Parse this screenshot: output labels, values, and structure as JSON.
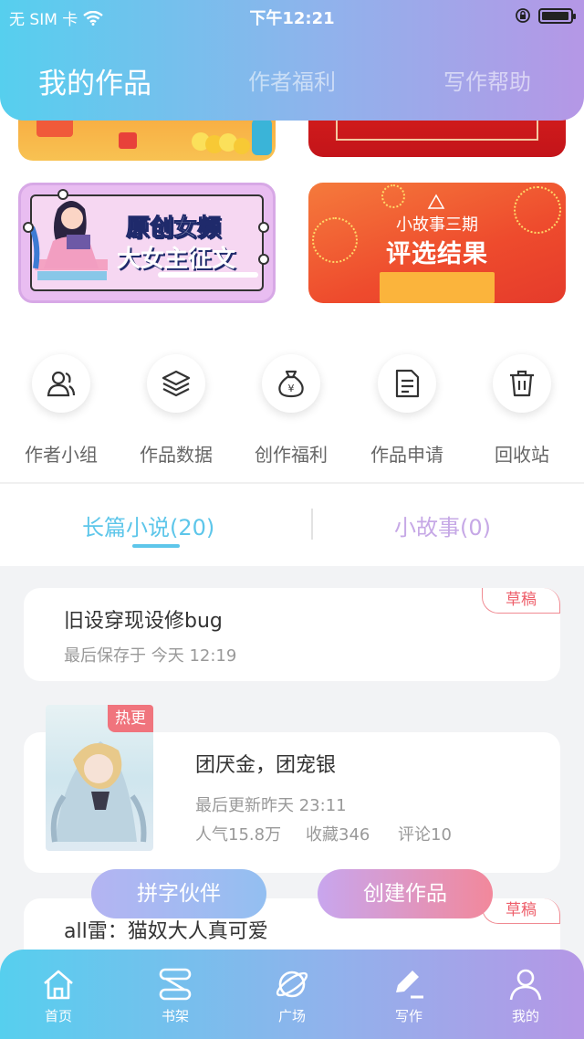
{
  "status_bar": {
    "carrier": "无 SIM 卡",
    "time": "下午12:21",
    "battery_level": 0.95
  },
  "header": {
    "tabs": [
      {
        "label": "我的作品",
        "active": true
      },
      {
        "label": "作者福利",
        "active": false
      },
      {
        "label": "写作帮助",
        "active": false
      }
    ]
  },
  "banners": [
    {
      "title": "原创女频",
      "subtitle": "大女主征文"
    },
    {
      "title": "小故事三期",
      "subtitle": "评选结果"
    }
  ],
  "shortcuts": [
    {
      "label": "作者小组",
      "icon": "group-icon"
    },
    {
      "label": "作品数据",
      "icon": "layers-icon"
    },
    {
      "label": "创作福利",
      "icon": "money-bag-icon"
    },
    {
      "label": "作品申请",
      "icon": "document-icon"
    },
    {
      "label": "回收站",
      "icon": "trash-icon"
    }
  ],
  "list_tabs": [
    {
      "label": "长篇小说(20)",
      "active": true
    },
    {
      "label": "小故事(0)",
      "active": false
    }
  ],
  "works": [
    {
      "title": "旧设穿现设修bug",
      "meta": "最后保存于 今天 12:19",
      "badge": "草稿"
    },
    {
      "title": "团厌金，团宠银",
      "meta": "最后更新昨天 23:11",
      "badge": "热更",
      "popularity": "人气15.8万",
      "favorites": "收藏346",
      "comments": "评论10"
    },
    {
      "title": "all雷：猫奴大人真可爱",
      "badge": "草稿"
    }
  ],
  "fabs": {
    "partner": "拼字伙伴",
    "create": "创建作品"
  },
  "tabbar": [
    {
      "label": "首页",
      "icon": "home-icon"
    },
    {
      "label": "书架",
      "icon": "bookshelf-icon"
    },
    {
      "label": "广场",
      "icon": "planet-icon"
    },
    {
      "label": "写作",
      "icon": "write-icon"
    },
    {
      "label": "我的",
      "icon": "profile-icon"
    }
  ],
  "colors": {
    "gradient_start": "#56cfee",
    "gradient_end": "#b597e6",
    "accent": "#5dc6ea",
    "draft_red": "#ee5f6b"
  }
}
